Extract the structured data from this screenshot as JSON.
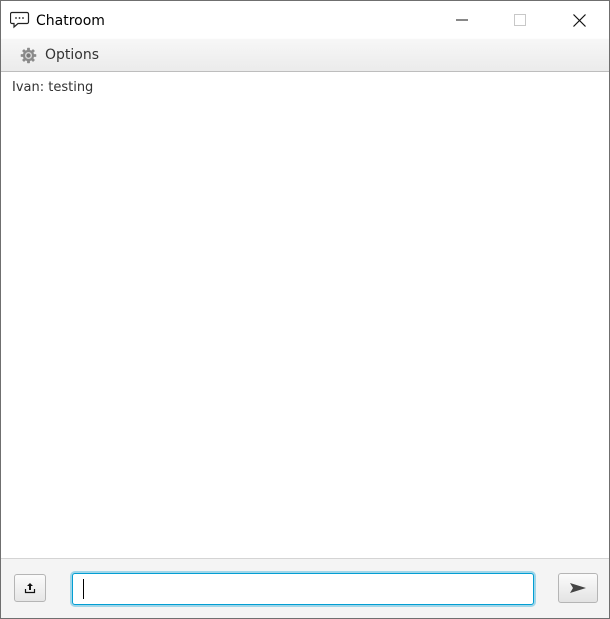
{
  "window": {
    "title": "Chatroom",
    "icons": {
      "app": "chat-bubble-icon",
      "minimize": "minimize-icon",
      "maximize": "maximize-icon",
      "close": "close-icon"
    }
  },
  "menubar": {
    "items": [
      {
        "label": "Options",
        "icon": "gear-icon"
      }
    ]
  },
  "chat": {
    "messages": [
      {
        "text": "Ivan: testing"
      }
    ]
  },
  "composer": {
    "input_value": "",
    "input_placeholder": "",
    "upload_icon": "upload-icon",
    "send_icon": "send-icon",
    "accent_color": "#039ed3"
  }
}
